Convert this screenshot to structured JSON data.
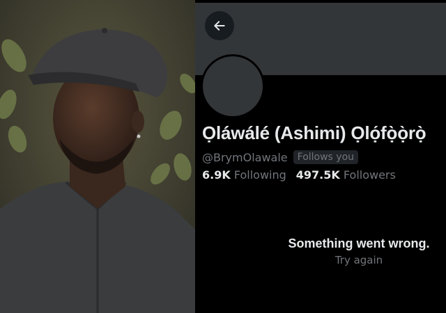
{
  "profile": {
    "name": "Ọláwálé (Ashimi) Ọlọ́fọ̀ọ̀rọ̀",
    "handle": "@BrymOlawale",
    "follows_badge": "Follows you",
    "following_count": "6.9K",
    "following_label": "Following",
    "followers_count": "497.5K",
    "followers_label": "Followers"
  },
  "error": {
    "title": "Something went wrong.",
    "retry_label": "Try again"
  },
  "icons": {
    "back": "arrow-left-icon"
  },
  "colors": {
    "background": "#000000",
    "banner": "#333639",
    "primary_text": "#e7e9ea",
    "secondary_text": "#71767b"
  }
}
